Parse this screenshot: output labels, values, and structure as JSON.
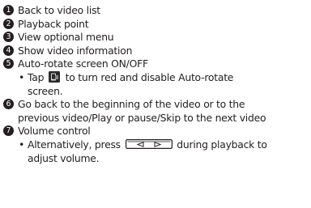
{
  "items": [
    {
      "num": "1",
      "text": "Back to video list"
    },
    {
      "num": "2",
      "text": "Playback point"
    },
    {
      "num": "3",
      "text": "View optional menu"
    },
    {
      "num": "4",
      "text": "Show video information"
    },
    {
      "num": "5",
      "text": "Auto-rotate screen ON/OFF"
    },
    {
      "num": "6",
      "line1": "Go back to the beginning of the video or to the",
      "line2": "previous video/Play or pause/Skip to the next video"
    },
    {
      "num": "7",
      "text": "Volume control"
    }
  ],
  "notes": {
    "rotate": {
      "bullet": "•",
      "before": "Tap",
      "after": "to turn red and disable Auto-rotate",
      "line2": "screen.",
      "icon": "auto-rotate-icon"
    },
    "volume": {
      "bullet": "•",
      "before": "Alternatively, press",
      "after": "during playback to",
      "line2": "adjust volume.",
      "icon": "volume-key-icon"
    }
  }
}
